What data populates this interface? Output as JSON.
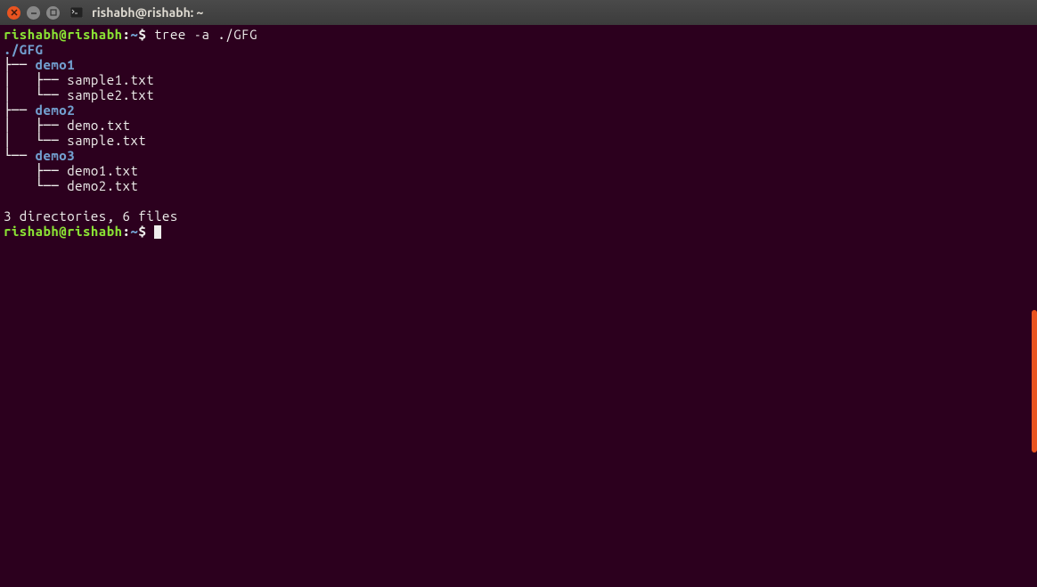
{
  "titlebar": {
    "title": "rishabh@rishabh: ~"
  },
  "prompt1": {
    "user": "rishabh@rishabh",
    "sep": ":",
    "path": "~",
    "dollar": "$ ",
    "command": "tree -a ./GFG"
  },
  "tree": {
    "root": "./GFG",
    "lines": [
      {
        "prefix": "├── ",
        "name": "demo1",
        "is_dir": true
      },
      {
        "prefix": "│   ├── ",
        "name": "sample1.txt",
        "is_dir": false
      },
      {
        "prefix": "│   └── ",
        "name": "sample2.txt",
        "is_dir": false
      },
      {
        "prefix": "├── ",
        "name": "demo2",
        "is_dir": true
      },
      {
        "prefix": "│   ├── ",
        "name": "demo.txt",
        "is_dir": false
      },
      {
        "prefix": "│   └── ",
        "name": "sample.txt",
        "is_dir": false
      },
      {
        "prefix": "└── ",
        "name": "demo3",
        "is_dir": true
      },
      {
        "prefix": "    ├── ",
        "name": "demo1.txt",
        "is_dir": false
      },
      {
        "prefix": "    └── ",
        "name": "demo2.txt",
        "is_dir": false
      }
    ],
    "summary_blank": "",
    "summary": "3 directories, 6 files"
  },
  "prompt2": {
    "user": "rishabh@rishabh",
    "sep": ":",
    "path": "~",
    "dollar": "$ "
  }
}
